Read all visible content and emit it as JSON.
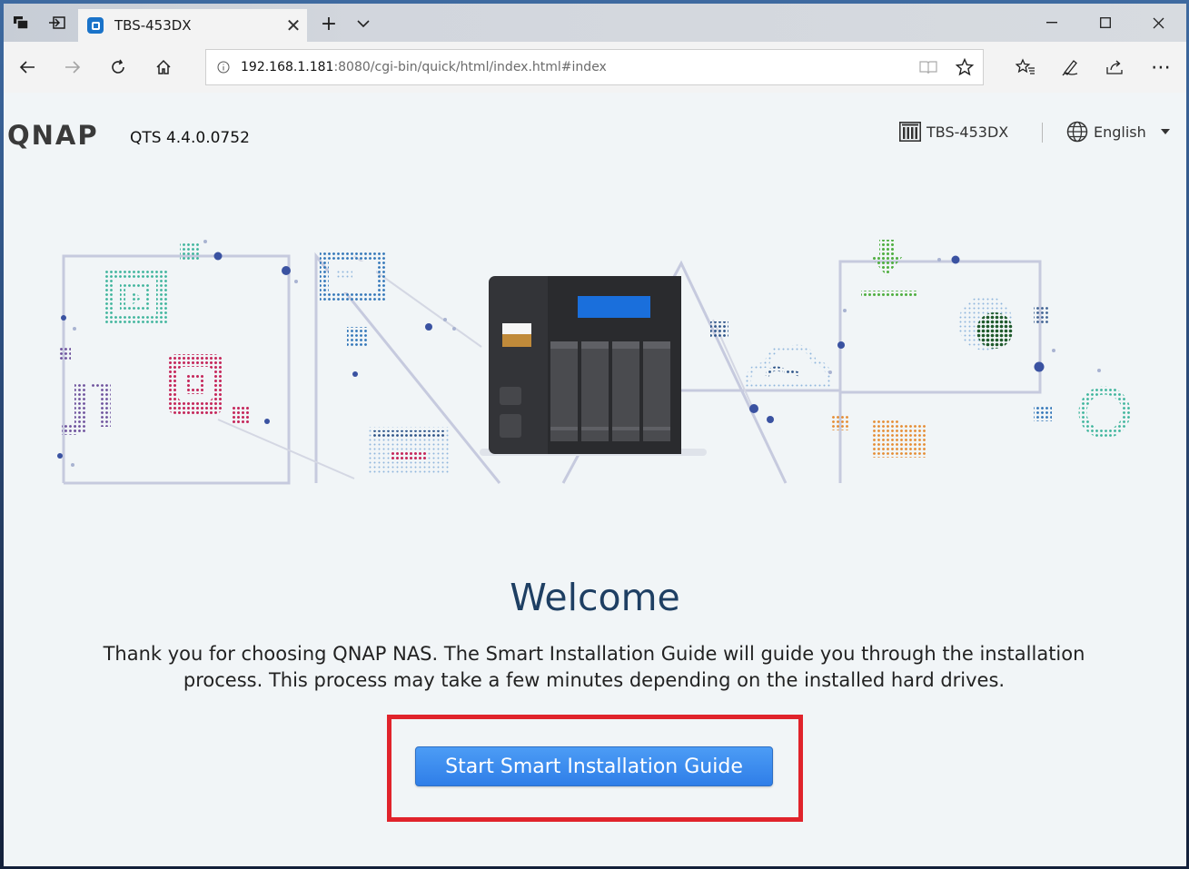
{
  "browser": {
    "tab_title": "TBS-453DX",
    "url_host": "192.168.1.181",
    "url_rest": ":8080/cgi-bin/quick/html/index.html#index"
  },
  "header": {
    "logo": "QNAP",
    "version": "QTS 4.4.0.0752",
    "device_name": "TBS-453DX",
    "language": "English"
  },
  "main": {
    "welcome_title": "Welcome",
    "description_line1": "Thank you for choosing QNAP NAS. The Smart Installation Guide will guide you through the installation",
    "description_line2": "process. This process may take a few minutes depending on the installed hard drives.",
    "start_button": "Start Smart Installation Guide"
  },
  "colors": {
    "accent_button": "#3a8bf0",
    "highlight_border": "#e0232b",
    "title": "#1e3f63"
  }
}
